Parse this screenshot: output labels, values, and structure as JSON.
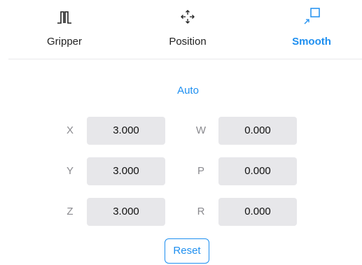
{
  "tabs": [
    {
      "label": "Gripper",
      "icon": "gripper-icon",
      "active": false
    },
    {
      "label": "Position",
      "icon": "move-arrows-icon",
      "active": false
    },
    {
      "label": "Smooth",
      "icon": "smooth-corner-icon",
      "active": true
    }
  ],
  "mode": "Auto",
  "fields": {
    "x": {
      "label": "X",
      "value": "3.000"
    },
    "y": {
      "label": "Y",
      "value": "3.000"
    },
    "z": {
      "label": "Z",
      "value": "3.000"
    },
    "w": {
      "label": "W",
      "value": "0.000"
    },
    "p": {
      "label": "P",
      "value": "0.000"
    },
    "r": {
      "label": "R",
      "value": "0.000"
    }
  },
  "reset_label": "Reset",
  "colors": {
    "accent": "#1e8ff0",
    "field_bg": "#e7e7ea",
    "axis_text": "#8a8a8f"
  }
}
